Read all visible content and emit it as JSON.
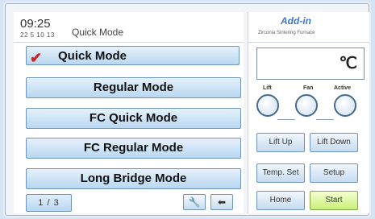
{
  "header": {
    "time": "09:25",
    "date": "22 5 10 13",
    "mode_label": "Quick Mode"
  },
  "brand": {
    "logo": "Add-in",
    "subtitle": "Zirconia Sintering Furnace"
  },
  "modes": [
    {
      "label": "Quick Mode",
      "selected": true
    },
    {
      "label": "Regular Mode",
      "selected": false
    },
    {
      "label": "FC Quick Mode",
      "selected": false
    },
    {
      "label": "FC Regular Mode",
      "selected": false
    },
    {
      "label": "Long Bridge Mode",
      "selected": false
    }
  ],
  "pager": {
    "label": "1 / 3"
  },
  "toolbar": {
    "tool_icon": "wrench-icon",
    "back_icon": "back-arrow-icon"
  },
  "temperature": {
    "unit": "℃"
  },
  "indicators": [
    {
      "label": "Lift"
    },
    {
      "label": "Fan"
    },
    {
      "label": "Active"
    }
  ],
  "controls": {
    "lift_up": "Lift Up",
    "lift_down": "Lift Down",
    "temp_set": "Temp. Set",
    "setup": "Setup",
    "home": "Home",
    "start": "Start"
  },
  "colors": {
    "accent": "#3f77c4",
    "check": "#d32020",
    "start": "#c9ef78"
  }
}
